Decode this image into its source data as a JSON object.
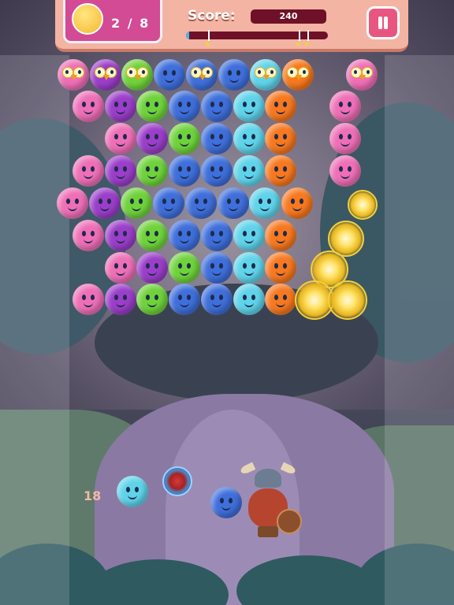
{
  "hud": {
    "counter_text": "2 / 8",
    "score_label": "Score:",
    "score_value": "240",
    "progress": 0.02,
    "pause_icon": "pause-icon",
    "counter_icon": "owl-icon"
  },
  "launcher": {
    "shots_left": "18",
    "current_bubble_color": "#3f6fdb",
    "next_bubble_color": "#5fd3ea"
  },
  "colors": {
    "pink": "#ee6fb7",
    "purple": "#9b3ec9",
    "green": "#6fd23b",
    "blue": "#3f6fdb",
    "cyan": "#5fd3ea",
    "orange": "#f7781f",
    "yellow": "#f7c53a"
  },
  "grid": [
    [
      "pink-owl",
      "purple-owl",
      "green-owl",
      "blue",
      "blue-owl",
      "blue",
      "cyan-owl",
      "orange-owl",
      null,
      "pink-owl"
    ],
    [
      "pink",
      "purple",
      "green",
      "blue",
      "blue",
      "cyan",
      "orange",
      null,
      "pink"
    ],
    [
      null,
      "pink",
      "purple",
      "green",
      "blue",
      "cyan",
      "orange",
      null,
      "pink"
    ],
    [
      "pink",
      "purple",
      "green",
      "blue",
      "blue",
      "cyan",
      "orange",
      null,
      "pink"
    ],
    [
      "pink",
      "purple",
      "green",
      "blue",
      "blue",
      "blue",
      "cyan",
      "orange"
    ],
    [
      "pink",
      "purple",
      "green",
      "blue",
      "blue",
      "cyan",
      "orange"
    ],
    [
      null,
      "pink",
      "purple",
      "green",
      "blue",
      "cyan",
      "orange"
    ],
    [
      "pink",
      "purple",
      "green",
      "blue",
      "blue",
      "cyan",
      "orange"
    ]
  ]
}
